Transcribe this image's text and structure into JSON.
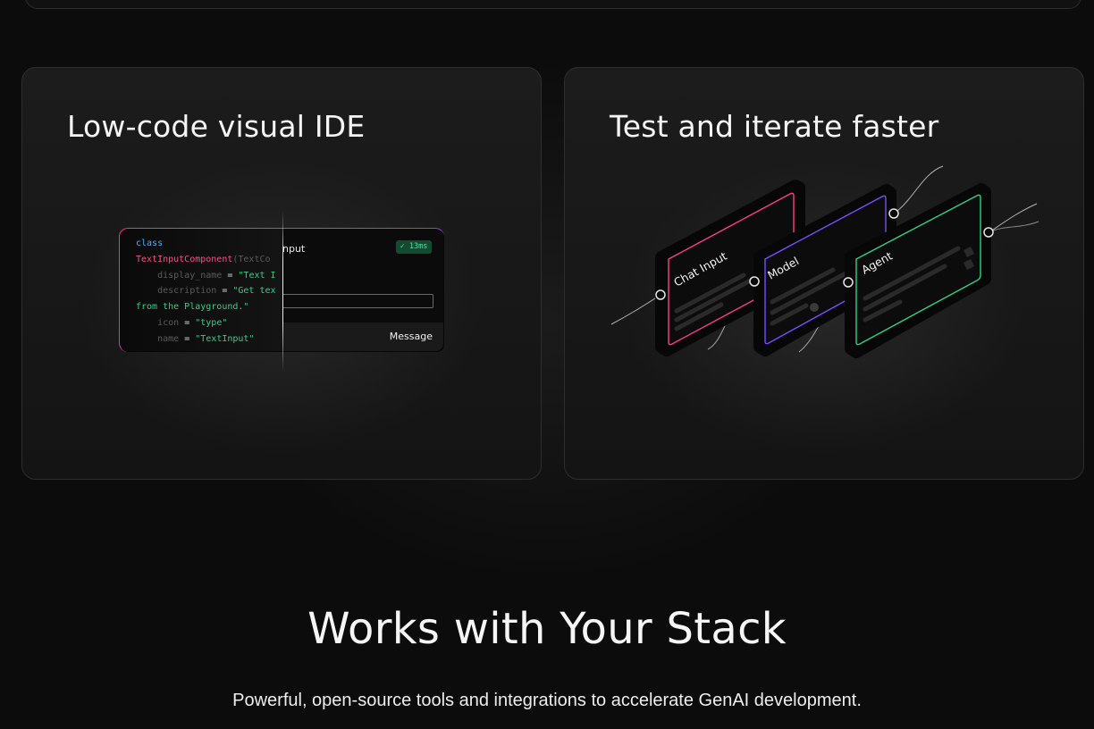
{
  "features": [
    {
      "title": "Low-code visual IDE",
      "code_lines": [
        [
          {
            "t": "class",
            "c": "kw"
          }
        ],
        [
          {
            "t": "TextInputComponent",
            "c": "cls"
          },
          {
            "t": "(TextCo",
            "c": "dim"
          }
        ],
        [
          {
            "t": "    display_name ",
            "c": "dim"
          },
          {
            "t": "= ",
            "c": "eq"
          },
          {
            "t": "\"Text I",
            "c": "str"
          }
        ],
        [
          {
            "t": "    description ",
            "c": "dim"
          },
          {
            "t": "= ",
            "c": "eq"
          },
          {
            "t": "\"Get tex",
            "c": "str"
          }
        ],
        [
          {
            "t": "from the Playground.\"",
            "c": "str"
          }
        ],
        [
          {
            "t": "    icon ",
            "c": "dim"
          },
          {
            "t": "= ",
            "c": "eq"
          },
          {
            "t": "\"type\"",
            "c": "str"
          }
        ],
        [
          {
            "t": "    name ",
            "c": "dim"
          },
          {
            "t": "= ",
            "c": "eq"
          },
          {
            "t": "\"TextInput\"",
            "c": "str"
          }
        ]
      ],
      "component_title": "nput",
      "badge": "✓ 13ms",
      "footer_label": "Message"
    },
    {
      "title": "Test and iterate faster",
      "nodes": [
        {
          "label": "Chat Input",
          "color": "#ff3d8a"
        },
        {
          "label": "Model",
          "color": "#7b4dff"
        },
        {
          "label": "Agent",
          "color": "#2fd08a"
        }
      ]
    }
  ],
  "section": {
    "heading": "Works with Your Stack",
    "subheading": "Powerful, open-source tools and integrations to accelerate GenAI development."
  }
}
